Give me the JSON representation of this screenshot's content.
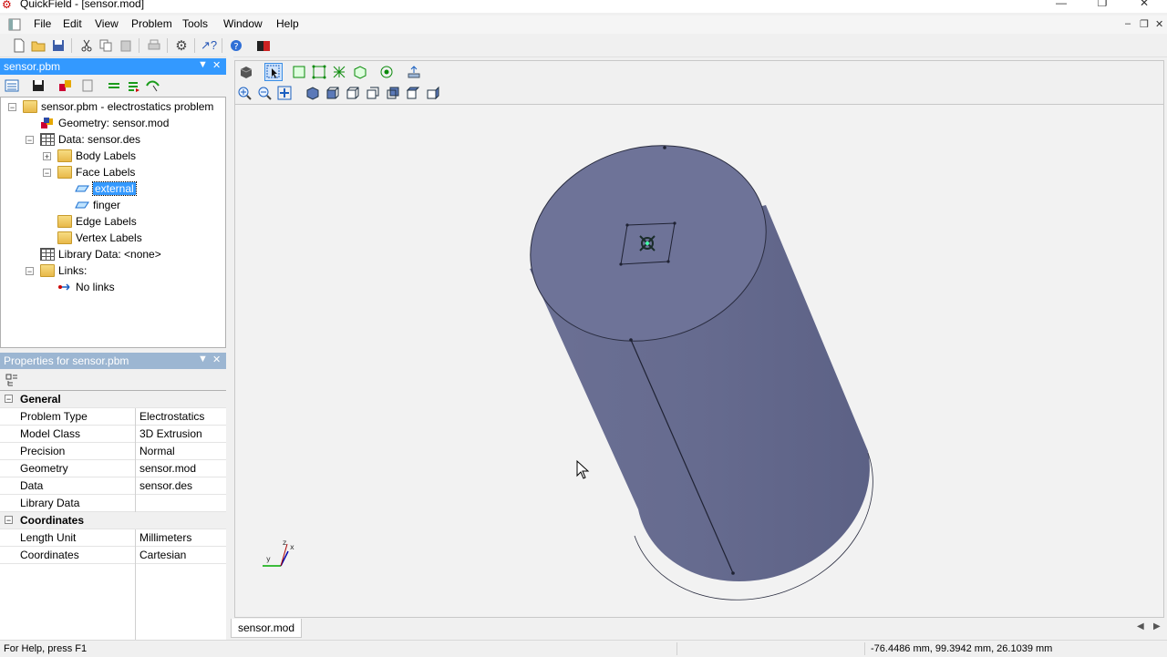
{
  "window": {
    "title": "QuickField - [sensor.mod]",
    "controls": [
      "minimize-icon",
      "restore-icon",
      "close-icon"
    ]
  },
  "menu": [
    "File",
    "Edit",
    "View",
    "Problem",
    "Tools",
    "Window",
    "Help"
  ],
  "problem_panel": {
    "title": "sensor.pbm",
    "tree": {
      "root": "sensor.pbm - electrostatics problem",
      "geometry": "Geometry: sensor.mod",
      "data": "Data: sensor.des",
      "body_labels": "Body Labels",
      "face_labels": "Face Labels",
      "face_external": "external",
      "face_finger": "finger",
      "edge_labels": "Edge Labels",
      "vertex_labels": "Vertex Labels",
      "library_data": "Library Data: <none>",
      "links": "Links:",
      "no_links": "No links"
    }
  },
  "properties_panel": {
    "title": "Properties for sensor.pbm",
    "general": "General",
    "rows_general": [
      {
        "name": "Problem Type",
        "value": "Electrostatics"
      },
      {
        "name": "Model Class",
        "value": "3D Extrusion"
      },
      {
        "name": "Precision",
        "value": "Normal"
      },
      {
        "name": "Geometry",
        "value": "sensor.mod"
      },
      {
        "name": "Data",
        "value": "sensor.des"
      },
      {
        "name": "Library Data",
        "value": ""
      }
    ],
    "coordinates": "Coordinates",
    "rows_coords": [
      {
        "name": "Length Unit",
        "value": "Millimeters"
      },
      {
        "name": "Coordinates",
        "value": "Cartesian"
      }
    ]
  },
  "viewport": {
    "axis_labels": {
      "x": "x",
      "y": "y",
      "z": "z"
    },
    "colors": {
      "body": "#6f7599",
      "body_side": "#5f6489",
      "face_top": "#6e7398"
    }
  },
  "tabs": {
    "active": "sensor.mod"
  },
  "status": {
    "help": "For Help, press F1",
    "coords": "-76.4486 mm, 99.3942 mm, 26.1039 mm"
  }
}
